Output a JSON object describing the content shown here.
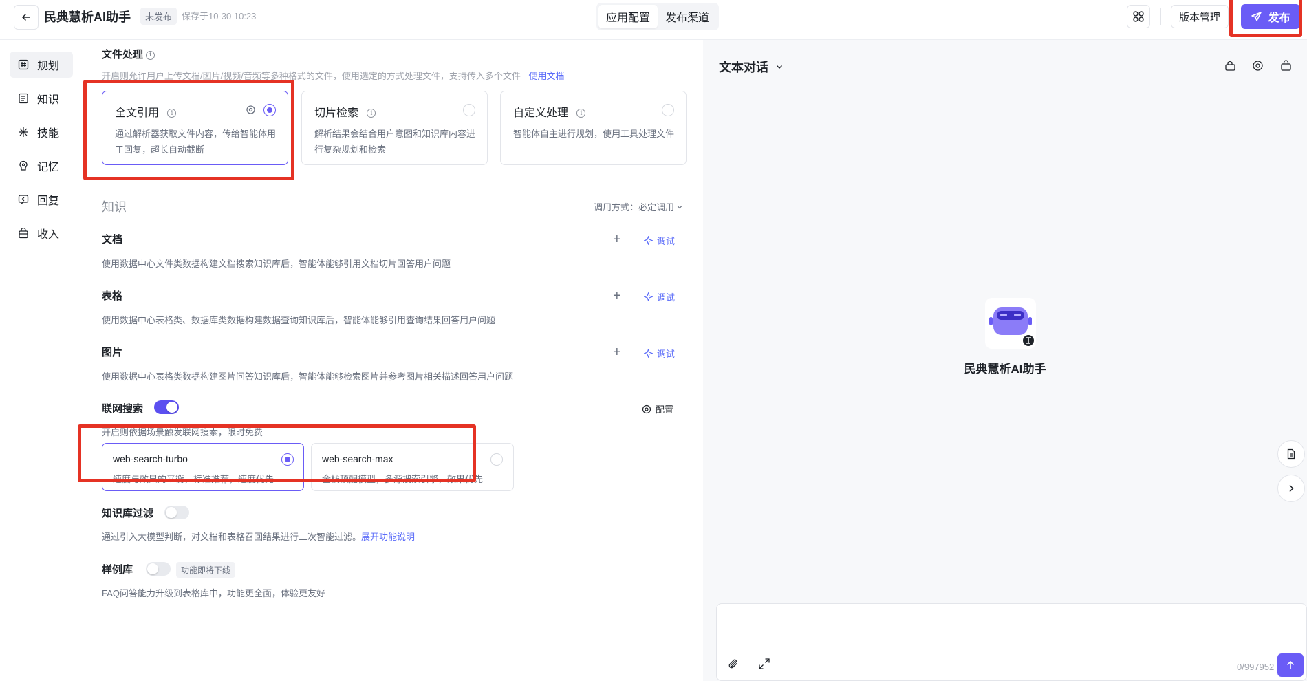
{
  "header": {
    "app_title": "民典慧析AI助手",
    "status_badge": "未发布",
    "saved_at": "保存于10-30 10:23",
    "tabs": [
      {
        "label": "应用配置",
        "active": true
      },
      {
        "label": "发布渠道",
        "active": false
      }
    ],
    "version_label": "版本管理",
    "publish_label": "发布"
  },
  "sidebar": {
    "items": [
      {
        "label": "规划",
        "icon": "hash-icon",
        "active": true
      },
      {
        "label": "知识",
        "icon": "book-icon",
        "active": false
      },
      {
        "label": "技能",
        "icon": "skill-icon",
        "active": false
      },
      {
        "label": "记忆",
        "icon": "memory-icon",
        "active": false
      },
      {
        "label": "回复",
        "icon": "reply-icon",
        "active": false
      },
      {
        "label": "收入",
        "icon": "bag-icon",
        "active": false
      }
    ]
  },
  "file_processing": {
    "title": "文件处理",
    "desc": "开启则允许用户上传文档/图片/视频/音频等多种格式的文件，使用选定的方式处理文件，支持传入多个文件",
    "doc_link": "使用文档",
    "options": [
      {
        "title": "全文引用",
        "desc": "通过解析器获取文件内容，传给智能体用于回复，超长自动截断",
        "selected": true
      },
      {
        "title": "切片检索",
        "desc": "解析结果会结合用户意图和知识库内容进行复杂规划和检索",
        "selected": false
      },
      {
        "title": "自定义处理",
        "desc": "智能体自主进行规划，使用工具处理文件",
        "selected": false
      }
    ]
  },
  "knowledge": {
    "title": "知识",
    "call_mode": "调用方式：必定调用",
    "debug_label": "调试",
    "sources": [
      {
        "title": "文档",
        "desc": "使用数据中心文件类数据构建文档搜索知识库后，智能体能够引用文档切片回答用户问题"
      },
      {
        "title": "表格",
        "desc": "使用数据中心表格类、数据库类数据构建数据查询知识库后，智能体能够引用查询结果回答用户问题"
      },
      {
        "title": "图片",
        "desc": "使用数据中心表格类数据构建图片问答知识库后，智能体能够检索图片并参考图片相关描述回答用户问题"
      }
    ]
  },
  "web_search": {
    "title": "联网搜索",
    "enabled": true,
    "desc": "开启则依据场景触发联网搜索，限时免费",
    "config_label": "配置",
    "models": [
      {
        "name": "web-search-turbo",
        "desc": "速度与效果的平衡，标准推荐，速度优先",
        "selected": true
      },
      {
        "name": "web-search-max",
        "desc": "全栈顶配模型，多源搜索引擎，效果优先",
        "selected": false
      }
    ]
  },
  "kb_filter": {
    "title": "知识库过滤",
    "enabled": false,
    "desc": "通过引入大模型判断，对文档和表格召回结果进行二次智能过滤。",
    "link": "展开功能说明"
  },
  "sample_lib": {
    "title": "样例库",
    "enabled": false,
    "tag": "功能即将下线",
    "desc": "FAQ问答能力升级到表格库中，功能更全面，体验更友好"
  },
  "preview": {
    "mode_label": "文本对话",
    "bot_name": "民典慧析AI助手",
    "counter": "0/997952"
  },
  "colors": {
    "accent": "#6a5cf6",
    "highlight_box": "#e53224",
    "link": "#5b6cf9"
  }
}
